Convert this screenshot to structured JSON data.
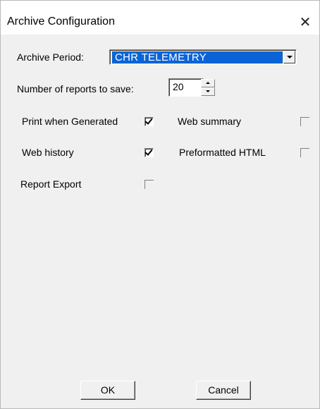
{
  "window": {
    "title": "Archive Configuration",
    "close_glyph": "✕"
  },
  "archive_period": {
    "label": "Archive Period:",
    "selected": "CHR TELEMETRY"
  },
  "reports": {
    "label": "Number of reports to save:",
    "value": "20"
  },
  "options": [
    {
      "label": "Print when Generated",
      "checked": true
    },
    {
      "label": "Web summary",
      "checked": false
    },
    {
      "label": "Web history",
      "checked": true
    },
    {
      "label": "Preformatted HTML",
      "checked": false
    },
    {
      "label": "Report Export",
      "checked": false
    }
  ],
  "buttons": {
    "ok": "OK",
    "cancel": "Cancel"
  },
  "icons": {
    "close": "close-icon",
    "dropdown": "chevron-down-icon",
    "spin_up": "spin-up-icon",
    "spin_down": "spin-down-icon",
    "check": "check-icon"
  }
}
